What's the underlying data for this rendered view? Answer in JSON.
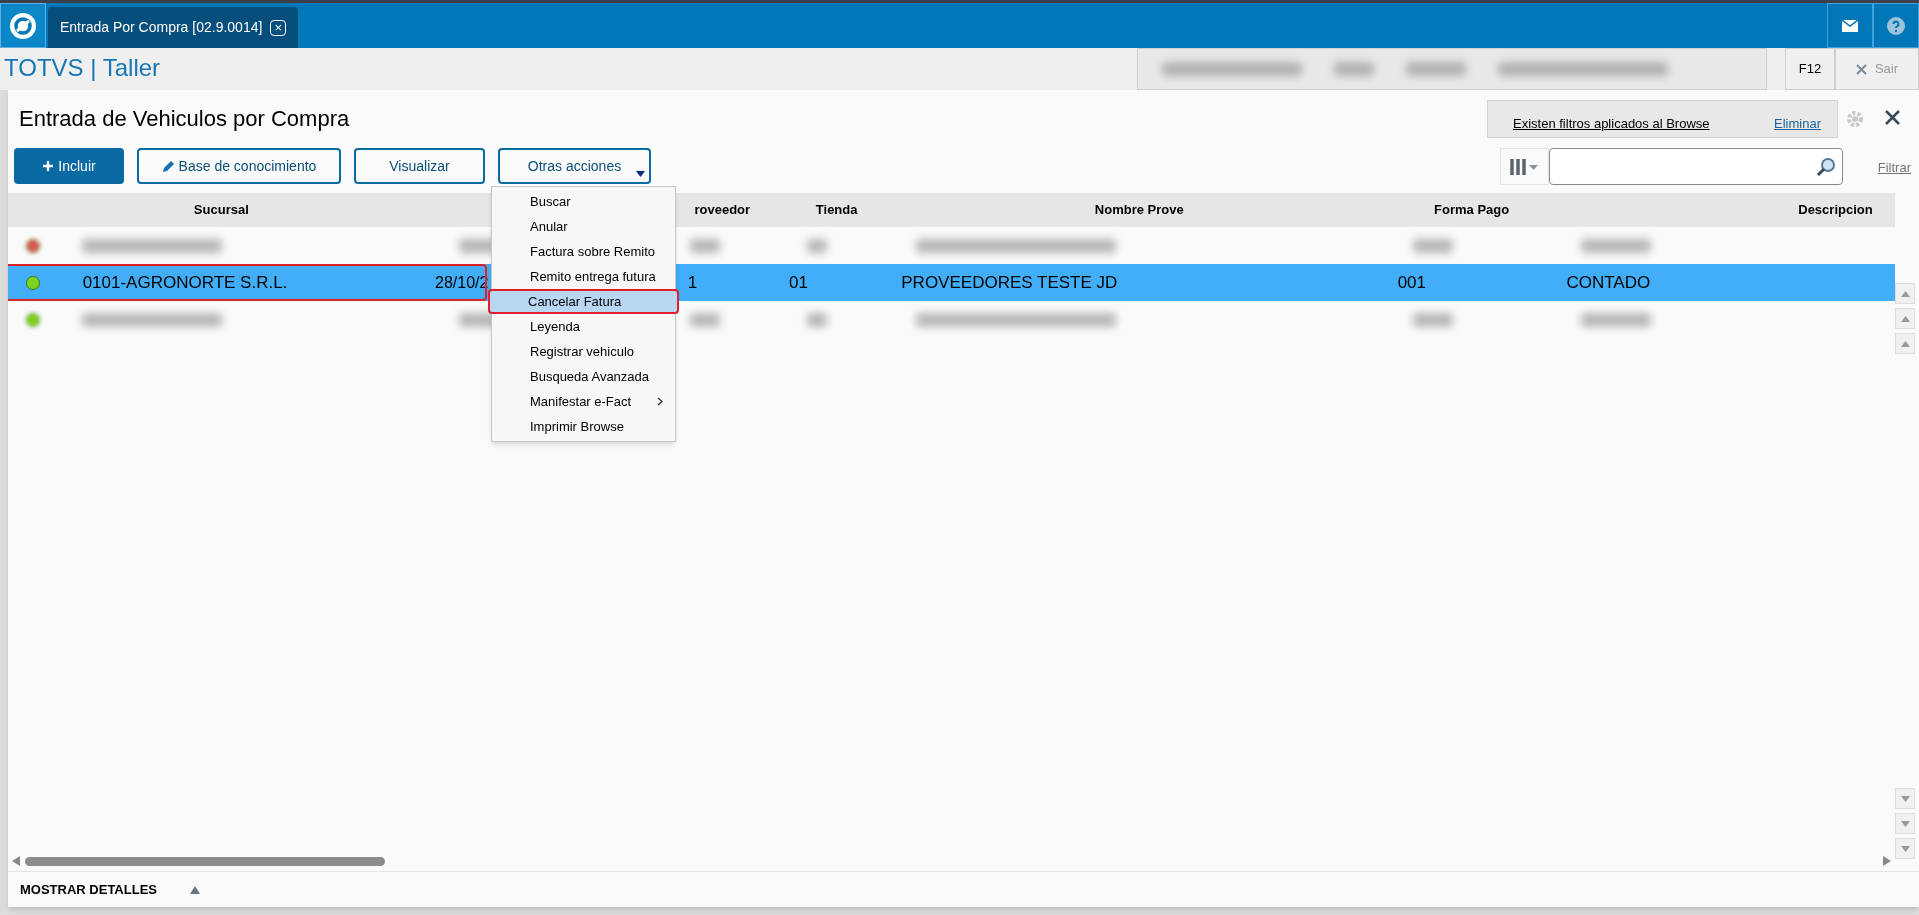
{
  "tab": {
    "title": "Entrada Por Compra [02.9.0014]",
    "close": "×"
  },
  "app_title": "TOTVS | Taller",
  "header_right": {
    "key": "F12",
    "exit": "Sair"
  },
  "page_title": "Entrada de Vehiculos por Compra",
  "filter_notice": {
    "text": "Existen filtros aplicados al Browse",
    "action": "Eliminar"
  },
  "buttons": [
    {
      "label": "Incluir",
      "kind": "primary"
    },
    {
      "label": "Base de conocimiento",
      "kind": "pencil"
    },
    {
      "label": "Visualizar",
      "kind": "plain"
    },
    {
      "label": "Otras acciones",
      "kind": "dropdown"
    }
  ],
  "filter_link": "Filtrar",
  "columns": [
    "Sucursal",
    "roveedor",
    "Tienda",
    "Nombre Prove",
    "Forma Pago",
    "Descripcion"
  ],
  "rows": [
    {
      "redacted": true,
      "selected": false,
      "annotated": false,
      "color": "#e05555"
    },
    {
      "redacted": false,
      "selected": true,
      "annotated": true,
      "color": "#7ed321",
      "cells": [
        "0101-AGRONORTE S.R.L.",
        "28/10/2",
        "1",
        "01",
        "PROVEEDORES TESTE JD",
        "001",
        "CONTADO"
      ]
    },
    {
      "redacted": true,
      "selected": false,
      "annotated": false,
      "color": "#7ed321"
    }
  ],
  "menu": [
    {
      "label": "Buscar",
      "selected": false,
      "annotated": false,
      "submenu": false
    },
    {
      "label": "Anular",
      "selected": false,
      "annotated": false,
      "submenu": false
    },
    {
      "label": "Factura sobre Remito",
      "selected": false,
      "annotated": false,
      "submenu": false
    },
    {
      "label": "Remito entrega futura",
      "selected": false,
      "annotated": false,
      "submenu": false
    },
    {
      "label": "Cancelar Fatura",
      "selected": true,
      "annotated": true,
      "submenu": false
    },
    {
      "label": "Leyenda",
      "selected": false,
      "annotated": false,
      "submenu": false
    },
    {
      "label": "Registrar vehiculo",
      "selected": false,
      "annotated": false,
      "submenu": false
    },
    {
      "label": "Busqueda Avanzada",
      "selected": false,
      "annotated": false,
      "submenu": false
    },
    {
      "label": "Manifestar e-Fact",
      "selected": false,
      "annotated": false,
      "submenu": true
    },
    {
      "label": "Imprimir Browse",
      "selected": false,
      "annotated": false,
      "submenu": false
    }
  ],
  "details_toggle": "MOSTRAR DETALLES"
}
